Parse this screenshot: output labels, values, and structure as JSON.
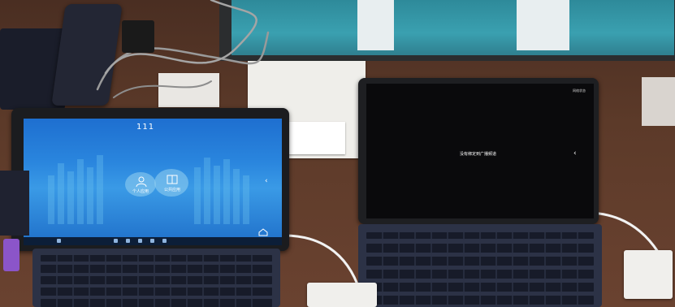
{
  "left_tablet": {
    "title": "111",
    "icon_labels": [
      "个人应用",
      "公共应用"
    ]
  },
  "right_tablet": {
    "message": "没有绑定到广播频道",
    "corner_label": "网络状态"
  },
  "colors": {
    "left_screen_accent": "#2a86de",
    "right_screen_bg": "#0a0a0c",
    "keyboard": "#2c3246",
    "desk": "#5c3a29"
  }
}
